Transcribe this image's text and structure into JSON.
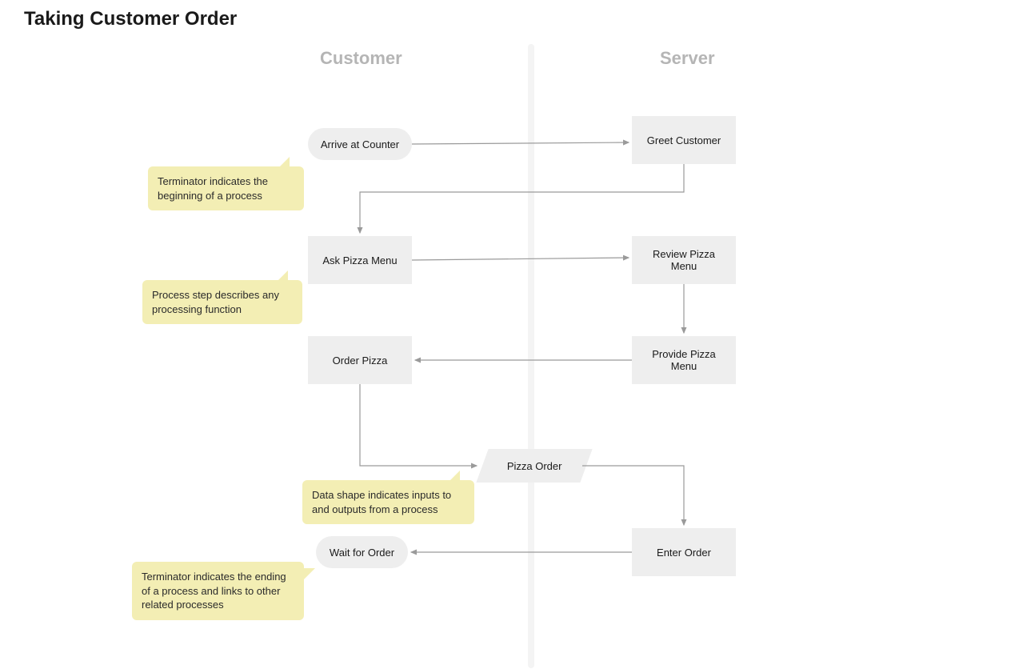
{
  "title": "Taking Customer Order",
  "lanes": {
    "customer": "Customer",
    "server": "Server"
  },
  "nodes": {
    "arrive": "Arrive at Counter",
    "greet": "Greet Customer",
    "ask_menu": "Ask Pizza Menu",
    "review_menu": "Review Pizza Menu",
    "provide_menu": "Provide Pizza Menu",
    "order_pizza": "Order Pizza",
    "pizza_order": "Pizza Order",
    "enter_order": "Enter Order",
    "wait_order": "Wait for Order"
  },
  "callouts": {
    "terminator_begin": "Terminator  indicates the beginning of a process",
    "process_step": "Process step describes any processing function",
    "data_shape": "Data shape indicates inputs to and outputs from a process",
    "terminator_end": "Terminator  indicates the ending of a process and links to other related processes"
  },
  "flow": [
    {
      "from": "arrive",
      "to": "greet"
    },
    {
      "from": "greet",
      "to": "ask_menu"
    },
    {
      "from": "ask_menu",
      "to": "review_menu"
    },
    {
      "from": "review_menu",
      "to": "provide_menu"
    },
    {
      "from": "provide_menu",
      "to": "order_pizza"
    },
    {
      "from": "order_pizza",
      "to": "pizza_order"
    },
    {
      "from": "pizza_order",
      "to": "enter_order"
    },
    {
      "from": "enter_order",
      "to": "wait_order"
    }
  ]
}
